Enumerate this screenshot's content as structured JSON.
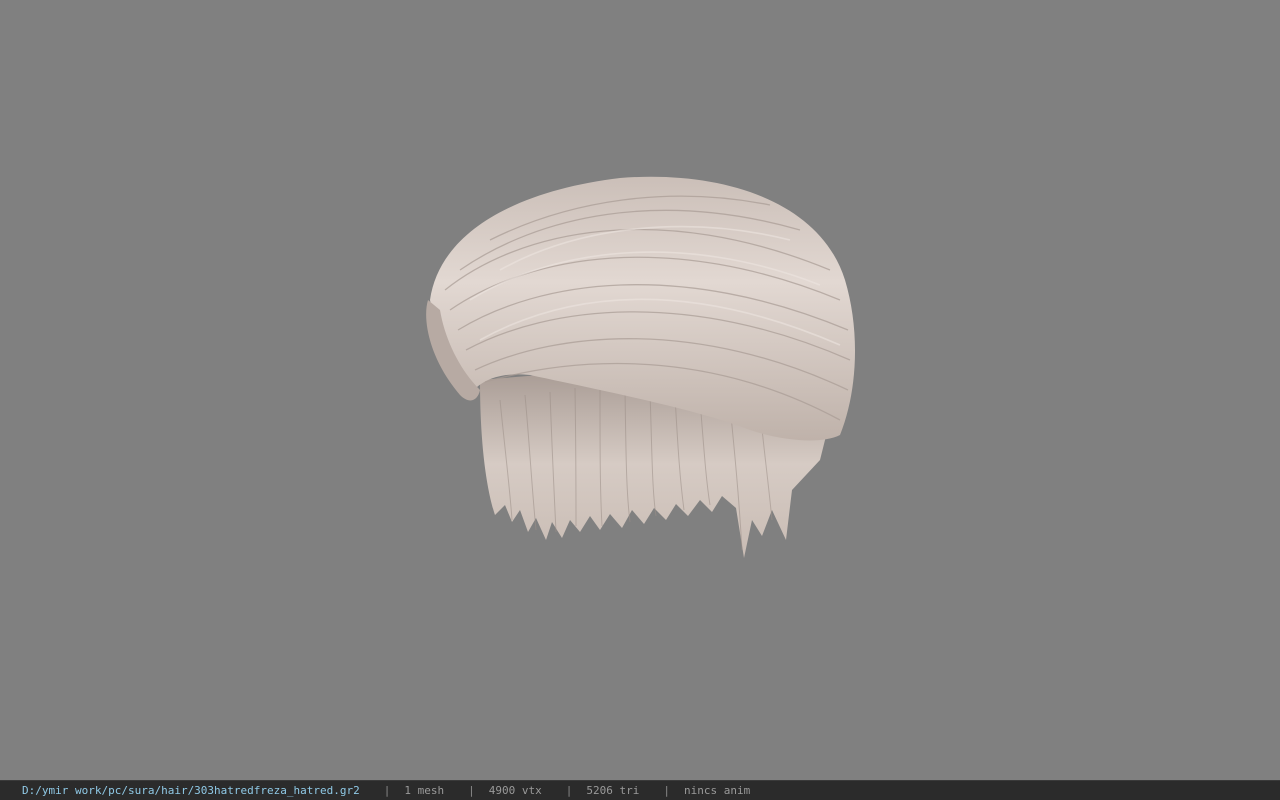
{
  "viewport": {
    "background_color": "#808080",
    "model_name": "hair-mesh",
    "model_color": "#d9cfc9"
  },
  "statusbar": {
    "file_path": "D:/ymir work/pc/sura/hair/303hatredfreza_hatred.gr2",
    "separator": "|",
    "mesh_count": "1 mesh",
    "vertex_count": "4900 vtx",
    "triangle_count": "5206 tri",
    "anim_status": "nincs anim",
    "path_color": "#8fc9e6"
  }
}
